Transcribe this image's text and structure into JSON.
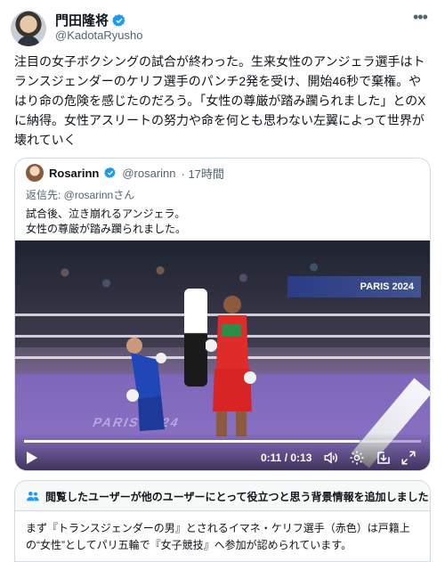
{
  "author": {
    "name": "門田隆将",
    "handle": "@KadotaRyusho"
  },
  "tweet_text": "注目の女子ボクシングの試合が終わった。生来女性のアンジェラ選手はトランスジェンダーのケリフ選手のパンチ2発を受け、開始46秒で棄権。やはり命の危険を感じたのだろう。「女性の尊厳が踏み躙られました」とのXに納得。女性アスリートの努力や命を何とも思わない左翼によって世界が壊れていく",
  "quoted": {
    "name": "Rosarinn",
    "handle": "@rosarinn",
    "time": "· 17時間",
    "reply_prefix": "返信先: ",
    "reply_handle": "@rosarinnさん",
    "lines": [
      "試合後、泣き崩れるアンジェラ。",
      "女性の尊厳が踏み躙られました。"
    ]
  },
  "video": {
    "banner_text": "PARIS 2024",
    "canvas_text": "PARIS 2024",
    "time": "0:11 / 0:13",
    "progress": 0.846
  },
  "community_note": {
    "title": "閲覧したユーザーが他のユーザーにとって役立つと思う背景情報を追加しました",
    "body": "まず『トランスジェンダーの男』とされるイマネ・ケリフ選手（赤色）は戸籍上の“女性”としてパリ五輪で『女子競技』へ参加が認められています。"
  },
  "colors": {
    "text": "#0f1419",
    "secondary": "#536471",
    "border": "#cfd9de",
    "verified": "#1d9bf0",
    "note_icon": "#1d9bf0"
  },
  "icons": [
    "verified-badge-icon",
    "more-icon",
    "play-icon",
    "volume-icon",
    "settings-icon",
    "download-icon",
    "fullscreen-icon",
    "note-people-icon"
  ]
}
